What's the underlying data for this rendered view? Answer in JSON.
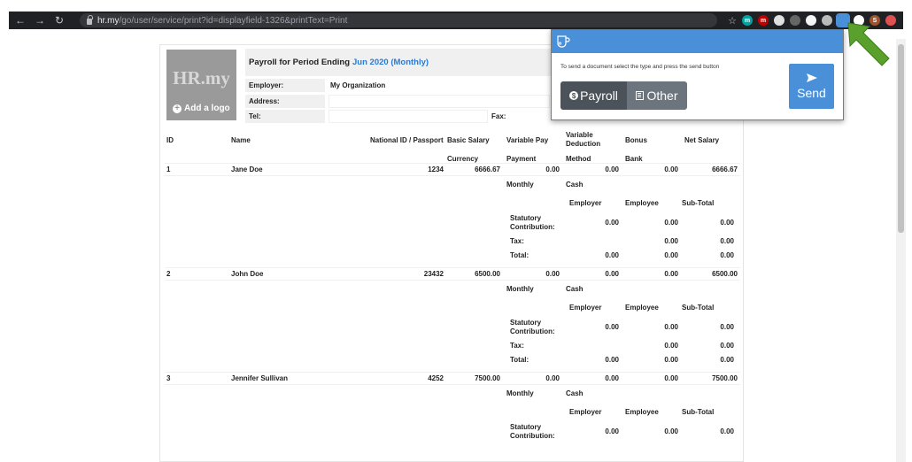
{
  "browser": {
    "url_host": "hr.my",
    "url_path": "/go/user/service/print?id=displayfield-1326&printText=Print",
    "extensions": [
      {
        "name": "m-ext-1",
        "label": "m",
        "color": "#00a2a2"
      },
      {
        "name": "m-ext-2",
        "label": "m",
        "color": "#c00000"
      },
      {
        "name": "circle-ext",
        "label": "",
        "color": "#e0e0e0"
      },
      {
        "name": "gear-ext",
        "label": "",
        "color": "#666666"
      },
      {
        "name": "shield-ext",
        "label": "",
        "color": "#f5f5f5"
      },
      {
        "name": "drive-ext",
        "label": "",
        "color": "#bbbbbb"
      },
      {
        "name": "cup-ext",
        "label": "",
        "color": "#4a90d9"
      },
      {
        "name": "puzzle-ext",
        "label": "",
        "color": "#ffffff"
      },
      {
        "name": "profile-ext",
        "label": "S",
        "color": "#a0522d"
      },
      {
        "name": "red-ext",
        "label": "",
        "color": "#e05050"
      }
    ]
  },
  "popup": {
    "instruction": "To send a document select the type and press the send button",
    "payroll_label": "Payroll",
    "other_label": "Other",
    "send_label": "Send",
    "accent": "#4a90d9"
  },
  "report": {
    "logo_text": "HR.my",
    "add_logo_label": "Add a logo",
    "title_prefix": "Payroll for Period Ending",
    "title_period": "Jun 2020 (Monthly)",
    "employer_label": "Employer:",
    "employer_value": "My Organization",
    "address_label": "Address:",
    "tel_label": "Tel:",
    "fax_label": "Fax:",
    "columns": {
      "id": "ID",
      "name": "Name",
      "national_id": "National ID / Passport",
      "basic_salary": "Basic Salary",
      "variable_pay": "Variable Pay",
      "variable_deduction": "Variable Deduction",
      "bonus": "Bonus",
      "net_salary": "Net Salary",
      "currency": "Currency",
      "payment": "Payment",
      "method": "Method",
      "bank": "Bank"
    },
    "breakdown_headers": {
      "employer": "Employer",
      "employee": "Employee",
      "subtotal": "Sub-Total"
    },
    "breakdown_labels": {
      "statutory": "Statutory Contribution:",
      "tax": "Tax:",
      "total": "Total:"
    },
    "employees": [
      {
        "id": "1",
        "name": "Jane Doe",
        "national_id": "1234",
        "basic_salary": "6666.67",
        "variable_pay": "0.00",
        "variable_deduction": "0.00",
        "bonus": "0.00",
        "net_salary": "6666.67",
        "payment": "Monthly",
        "method": "Cash",
        "statutory": {
          "employer": "0.00",
          "employee": "0.00",
          "subtotal": "0.00"
        },
        "tax": {
          "employee": "0.00",
          "subtotal": "0.00"
        },
        "total": {
          "employer": "0.00",
          "employee": "0.00",
          "subtotal": "0.00"
        }
      },
      {
        "id": "2",
        "name": "John Doe",
        "national_id": "23432",
        "basic_salary": "6500.00",
        "variable_pay": "0.00",
        "variable_deduction": "0.00",
        "bonus": "0.00",
        "net_salary": "6500.00",
        "payment": "Monthly",
        "method": "Cash",
        "statutory": {
          "employer": "0.00",
          "employee": "0.00",
          "subtotal": "0.00"
        },
        "tax": {
          "employee": "0.00",
          "subtotal": "0.00"
        },
        "total": {
          "employer": "0.00",
          "employee": "0.00",
          "subtotal": "0.00"
        }
      },
      {
        "id": "3",
        "name": "Jennifer Sullivan",
        "national_id": "4252",
        "basic_salary": "7500.00",
        "variable_pay": "0.00",
        "variable_deduction": "0.00",
        "bonus": "0.00",
        "net_salary": "7500.00",
        "payment": "Monthly",
        "method": "Cash",
        "statutory": {
          "employer": "0.00",
          "employee": "0.00",
          "subtotal": "0.00"
        }
      }
    ]
  }
}
